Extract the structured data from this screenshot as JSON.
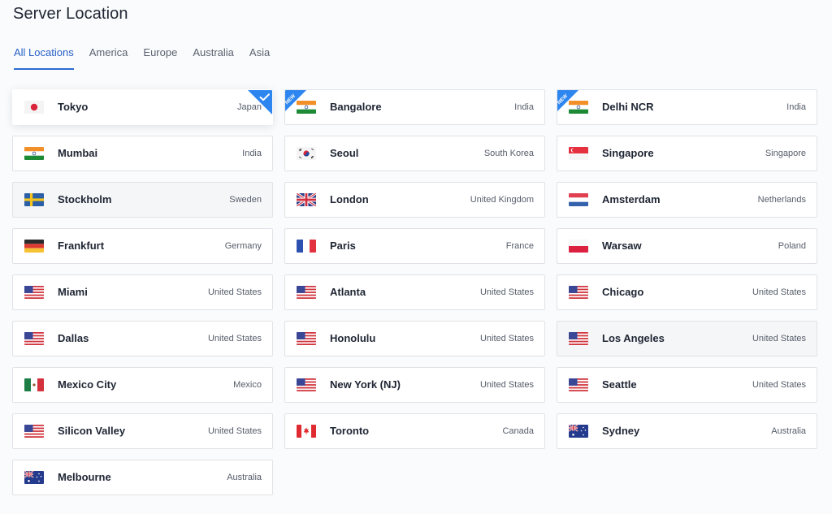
{
  "page": {
    "title": "Server Location"
  },
  "tabs": [
    {
      "label": "All Locations",
      "active": true
    },
    {
      "label": "America",
      "active": false
    },
    {
      "label": "Europe",
      "active": false
    },
    {
      "label": "Australia",
      "active": false
    },
    {
      "label": "Asia",
      "active": false
    }
  ],
  "badges": {
    "new": "NEW"
  },
  "colors": {
    "accent": "#2d6bd6",
    "badge": "#2d86f0"
  },
  "locations": [
    {
      "city": "Tokyo",
      "country": "Japan",
      "flag": "japan-flag-icon",
      "selected": true
    },
    {
      "city": "Bangalore",
      "country": "India",
      "flag": "india-flag-icon",
      "is_new": true
    },
    {
      "city": "Delhi NCR",
      "country": "India",
      "flag": "india-flag-icon",
      "is_new": true
    },
    {
      "city": "Mumbai",
      "country": "India",
      "flag": "india-flag-icon"
    },
    {
      "city": "Seoul",
      "country": "South Korea",
      "flag": "south-korea-flag-icon"
    },
    {
      "city": "Singapore",
      "country": "Singapore",
      "flag": "singapore-flag-icon"
    },
    {
      "city": "Stockholm",
      "country": "Sweden",
      "flag": "sweden-flag-icon",
      "hovered": true
    },
    {
      "city": "London",
      "country": "United Kingdom",
      "flag": "uk-flag-icon"
    },
    {
      "city": "Amsterdam",
      "country": "Netherlands",
      "flag": "netherlands-flag-icon"
    },
    {
      "city": "Frankfurt",
      "country": "Germany",
      "flag": "germany-flag-icon"
    },
    {
      "city": "Paris",
      "country": "France",
      "flag": "france-flag-icon"
    },
    {
      "city": "Warsaw",
      "country": "Poland",
      "flag": "poland-flag-icon"
    },
    {
      "city": "Miami",
      "country": "United States",
      "flag": "us-flag-icon"
    },
    {
      "city": "Atlanta",
      "country": "United States",
      "flag": "us-flag-icon"
    },
    {
      "city": "Chicago",
      "country": "United States",
      "flag": "us-flag-icon"
    },
    {
      "city": "Dallas",
      "country": "United States",
      "flag": "us-flag-icon"
    },
    {
      "city": "Honolulu",
      "country": "United States",
      "flag": "us-flag-icon"
    },
    {
      "city": "Los Angeles",
      "country": "United States",
      "flag": "us-flag-icon",
      "hovered": true
    },
    {
      "city": "Mexico City",
      "country": "Mexico",
      "flag": "mexico-flag-icon"
    },
    {
      "city": "New York (NJ)",
      "country": "United States",
      "flag": "us-flag-icon"
    },
    {
      "city": "Seattle",
      "country": "United States",
      "flag": "us-flag-icon"
    },
    {
      "city": "Silicon Valley",
      "country": "United States",
      "flag": "us-flag-icon"
    },
    {
      "city": "Toronto",
      "country": "Canada",
      "flag": "canada-flag-icon"
    },
    {
      "city": "Sydney",
      "country": "Australia",
      "flag": "australia-flag-icon"
    },
    {
      "city": "Melbourne",
      "country": "Australia",
      "flag": "australia-flag-icon"
    }
  ]
}
